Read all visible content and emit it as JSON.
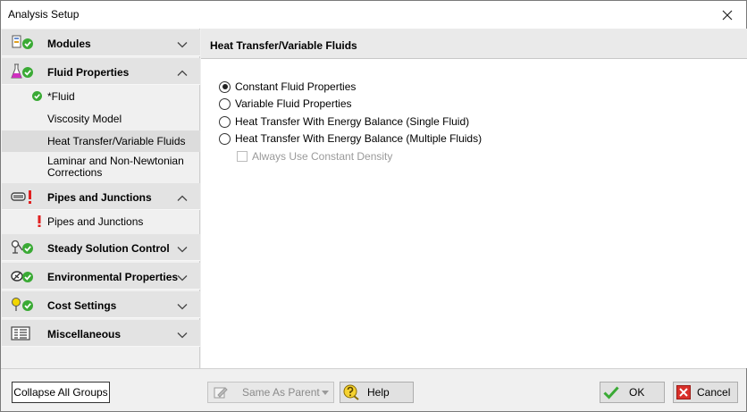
{
  "window": {
    "title": "Analysis Setup",
    "close_icon": "close-icon"
  },
  "sidebar": {
    "groups": [
      {
        "label": "Modules",
        "icon": "modules-icon",
        "status": "ok",
        "expanded": false
      },
      {
        "label": "Fluid Properties",
        "icon": "flask-icon",
        "status": "ok",
        "expanded": true,
        "items": [
          {
            "label": "*Fluid",
            "status": "ok"
          },
          {
            "label": "Viscosity Model"
          },
          {
            "label": "Heat Transfer/Variable Fluids",
            "selected": true
          },
          {
            "label": "Laminar and Non-Newtonian Corrections"
          }
        ]
      },
      {
        "label": "Pipes and Junctions",
        "icon": "pipe-icon",
        "status": "error",
        "expanded": true,
        "items": [
          {
            "label": "Pipes and Junctions",
            "status": "error"
          }
        ]
      },
      {
        "label": "Steady Solution Control",
        "icon": "solution-control-icon",
        "status": "ok",
        "expanded": false
      },
      {
        "label": "Environmental Properties",
        "icon": "environment-icon",
        "status": "ok",
        "expanded": false
      },
      {
        "label": "Cost Settings",
        "icon": "cost-icon",
        "status": "ok",
        "expanded": false
      },
      {
        "label": "Miscellaneous",
        "icon": "miscellaneous-icon",
        "status": "none",
        "expanded": false
      }
    ]
  },
  "content": {
    "title": "Heat Transfer/Variable Fluids",
    "options": [
      {
        "label": "Constant Fluid Properties",
        "checked": true
      },
      {
        "label": "Variable Fluid Properties",
        "checked": false
      },
      {
        "label": "Heat Transfer With Energy Balance (Single Fluid)",
        "checked": false
      },
      {
        "label": "Heat Transfer With Energy Balance (Multiple Fluids)",
        "checked": false
      }
    ],
    "always_density": {
      "label": "Always Use Constant Density",
      "checked": false,
      "disabled": true
    }
  },
  "footer": {
    "collapse_label": "Collapse All Groups",
    "same_as_parent_label": "Same As Parent",
    "help_label": "Help",
    "ok_label": "OK",
    "cancel_label": "Cancel"
  },
  "colors": {
    "ok_green": "#3aaa35",
    "error_red": "#e02020",
    "cancel_red": "#d9302a"
  }
}
